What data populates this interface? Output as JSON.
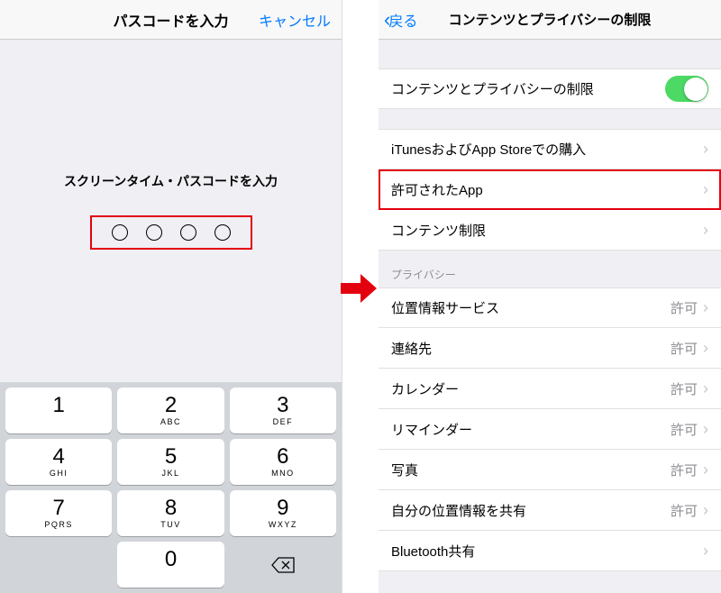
{
  "left": {
    "nav_title": "パスコードを入力",
    "nav_cancel": "キャンセル",
    "prompt": "スクリーンタイム・パスコードを入力",
    "keypad": [
      {
        "n": "1",
        "l": ""
      },
      {
        "n": "2",
        "l": "ABC"
      },
      {
        "n": "3",
        "l": "DEF"
      },
      {
        "n": "4",
        "l": "GHI"
      },
      {
        "n": "5",
        "l": "JKL"
      },
      {
        "n": "6",
        "l": "MNO"
      },
      {
        "n": "7",
        "l": "PQRS"
      },
      {
        "n": "8",
        "l": "TUV"
      },
      {
        "n": "9",
        "l": "WXYZ"
      },
      {
        "n": "0",
        "l": ""
      }
    ]
  },
  "right": {
    "nav_back": "戻る",
    "nav_title": "コンテンツとプライバシーの制限",
    "toggle_row": "コンテンツとプライバシーの制限",
    "rows1": [
      "iTunesおよびApp Storeでの購入",
      "許可されたApp",
      "コンテンツ制限"
    ],
    "section2_header": "プライバシー",
    "rows2": [
      {
        "label": "位置情報サービス",
        "value": "許可"
      },
      {
        "label": "連絡先",
        "value": "許可"
      },
      {
        "label": "カレンダー",
        "value": "許可"
      },
      {
        "label": "リマインダー",
        "value": "許可"
      },
      {
        "label": "写真",
        "value": "許可"
      },
      {
        "label": "自分の位置情報を共有",
        "value": "許可"
      },
      {
        "label": "Bluetooth共有",
        "value": ""
      }
    ]
  }
}
